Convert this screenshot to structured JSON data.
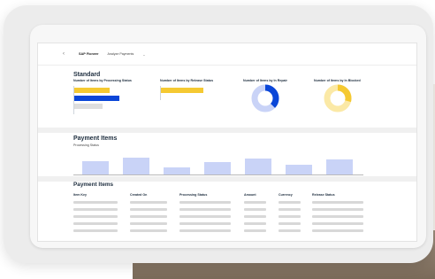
{
  "shellbar": {
    "back_icon": "chevron-left-icon",
    "brand_sap": "SAP",
    "brand_fioneer": "Fioneer",
    "app_title": "Analyze Payments",
    "dropdown_icon": "chevron-down-icon"
  },
  "standard": {
    "title": "Standard",
    "cards": [
      {
        "label": "Number of Items by Processing Status"
      },
      {
        "label": "Number of Items by Release Status"
      },
      {
        "label": "Number of Items by In Repair"
      },
      {
        "label": "Number of Items by In Blocked"
      }
    ]
  },
  "payment_items_chart": {
    "title": "Payment Items",
    "subtitle": "Processing Status"
  },
  "payment_items_table": {
    "title": "Payment Items",
    "columns": [
      "Item Key",
      "Created On",
      "Processing Status",
      "Amount",
      "Currency",
      "Release Status"
    ]
  },
  "colors": {
    "accent_yellow": "#f5c932",
    "accent_blue": "#0a46d8",
    "light_blue": "#c9d3f7",
    "placeholder_grey": "#d8d8d8"
  }
}
